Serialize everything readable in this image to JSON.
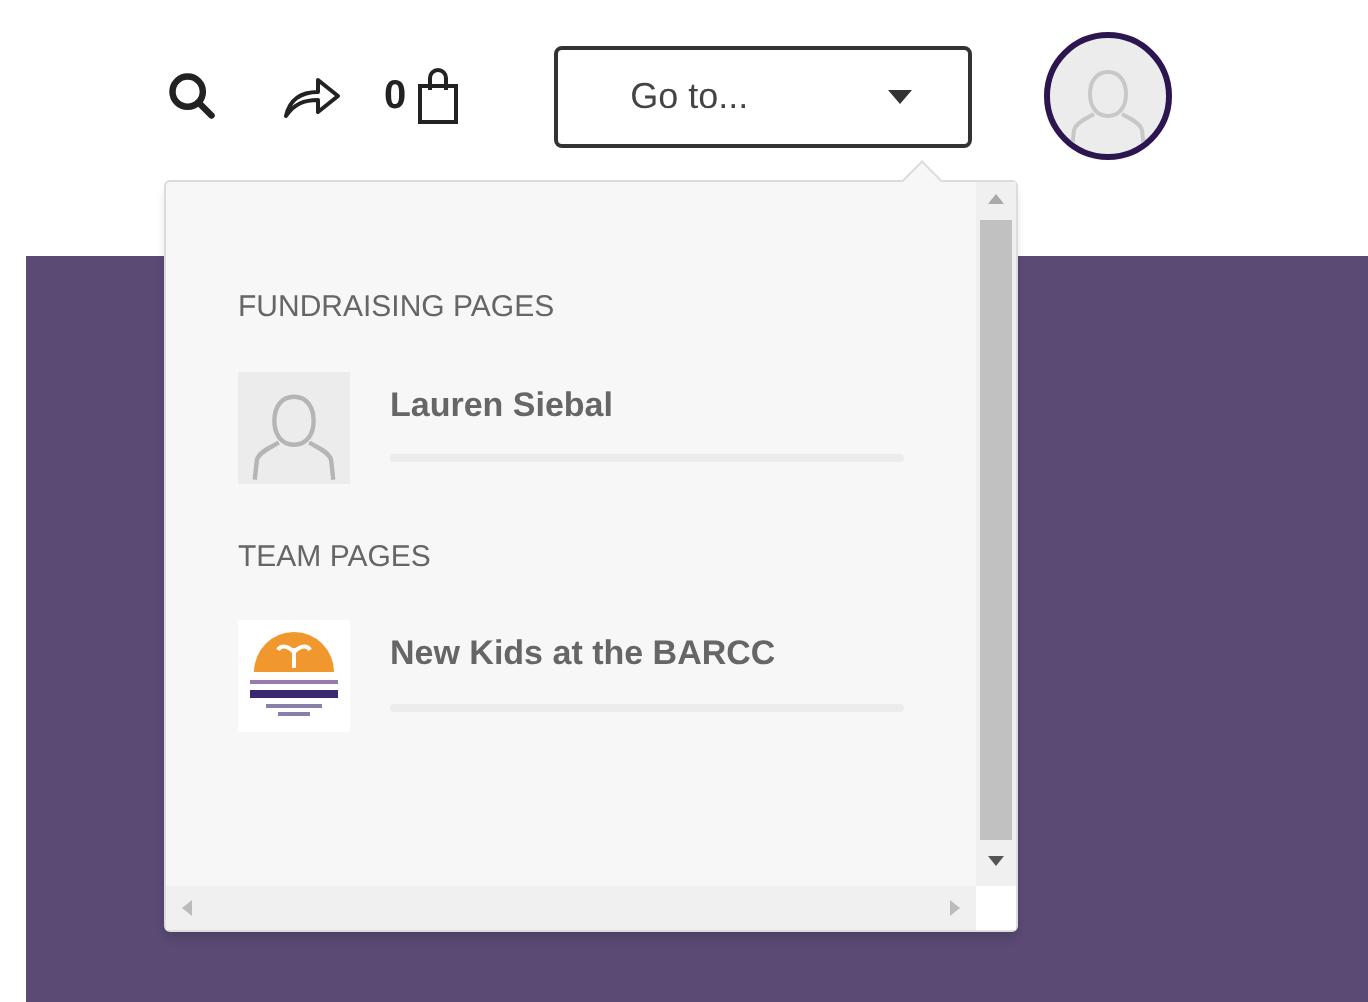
{
  "header": {
    "cart_count": "0",
    "goto_select": {
      "label": "Go to...",
      "expanded": true
    }
  },
  "dropdown": {
    "sections": [
      {
        "heading": "FUNDRAISING PAGES",
        "items": [
          {
            "kind": "person",
            "name": "Lauren Siebal",
            "level": 0
          }
        ]
      },
      {
        "heading": "TEAM PAGES",
        "items": [
          {
            "kind": "team",
            "name": "New Kids at the BARCC",
            "level": 0
          }
        ]
      }
    ]
  }
}
